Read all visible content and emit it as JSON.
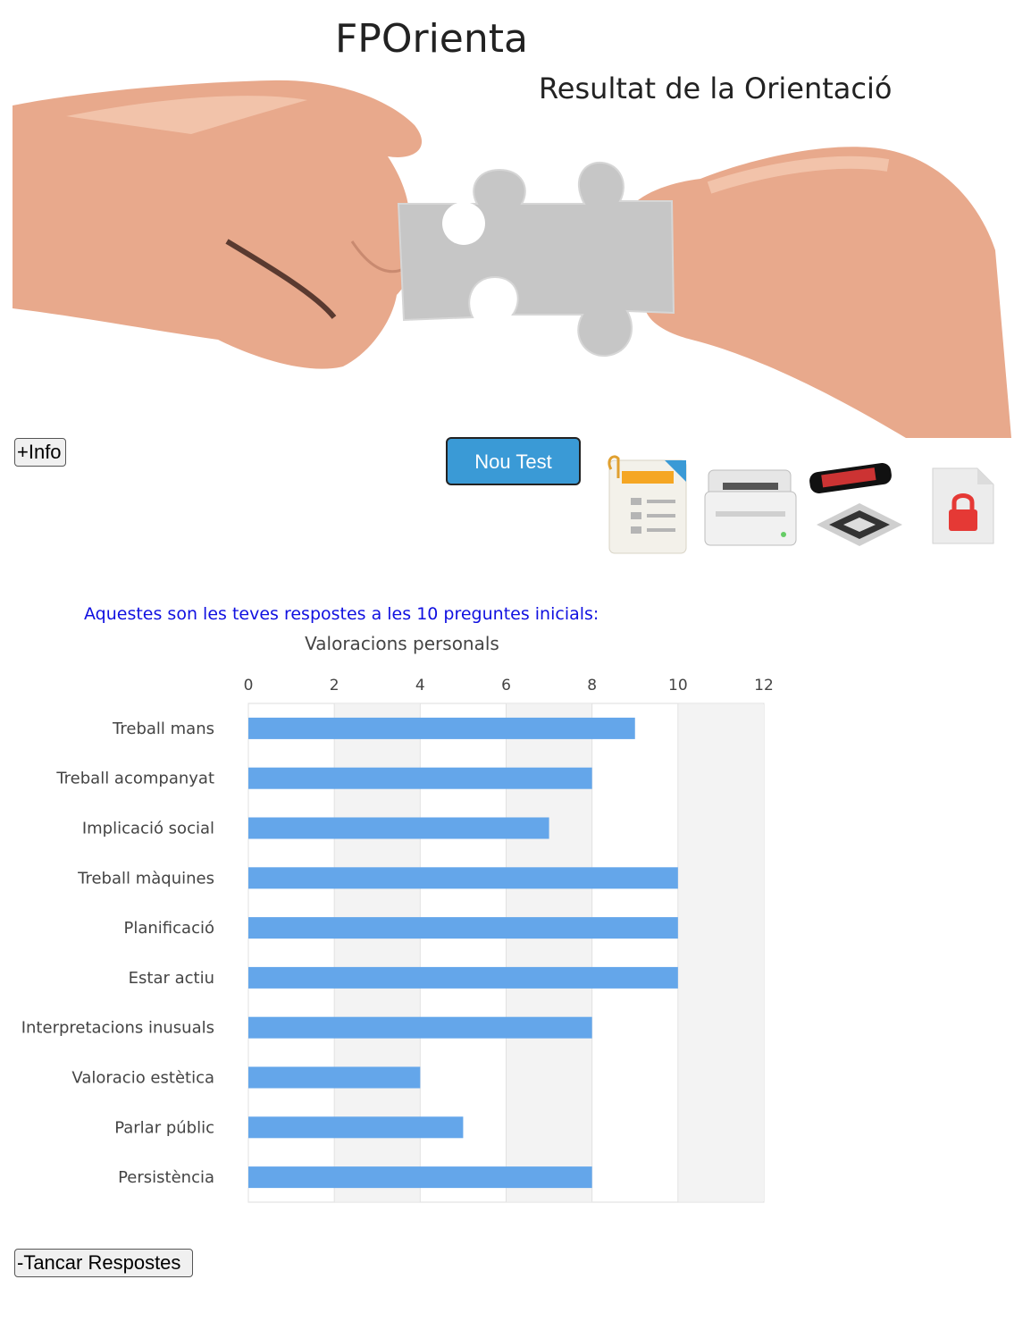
{
  "header": {
    "app_title": "FPOrienta",
    "subtitle": "Resultat de la Orientació"
  },
  "buttons": {
    "info": "+Info",
    "new_test": "Nou Test",
    "close_answers": "-Tancar Respostes"
  },
  "actions": [
    {
      "icon": "document-icon"
    },
    {
      "icon": "printer-icon"
    },
    {
      "icon": "qr-code-icon"
    },
    {
      "icon": "locked-pdf-icon"
    }
  ],
  "intro_text": "Aquestes son les teves respostes a les 10 preguntes inicials:",
  "colors": {
    "accent": "#3a9ad6",
    "bar": "#64a6ea",
    "intro_text": "#1010e0"
  },
  "chart_data": {
    "type": "bar",
    "orientation": "horizontal",
    "title": "Valoracions personals",
    "categories": [
      "Treball mans",
      "Treball acompanyat",
      "Implicació social",
      "Treball màquines",
      "Planificació",
      "Estar actiu",
      "Interpretacions inusuals",
      "Valoracio estètica",
      "Parlar públic",
      "Persistència"
    ],
    "values": [
      9,
      8,
      7,
      10,
      10,
      10,
      8,
      4,
      5,
      8
    ],
    "xlim": [
      0,
      12
    ],
    "xticks": [
      "0",
      "2",
      "4",
      "6",
      "8",
      "10",
      "12"
    ],
    "grid": true,
    "legend": "none"
  }
}
